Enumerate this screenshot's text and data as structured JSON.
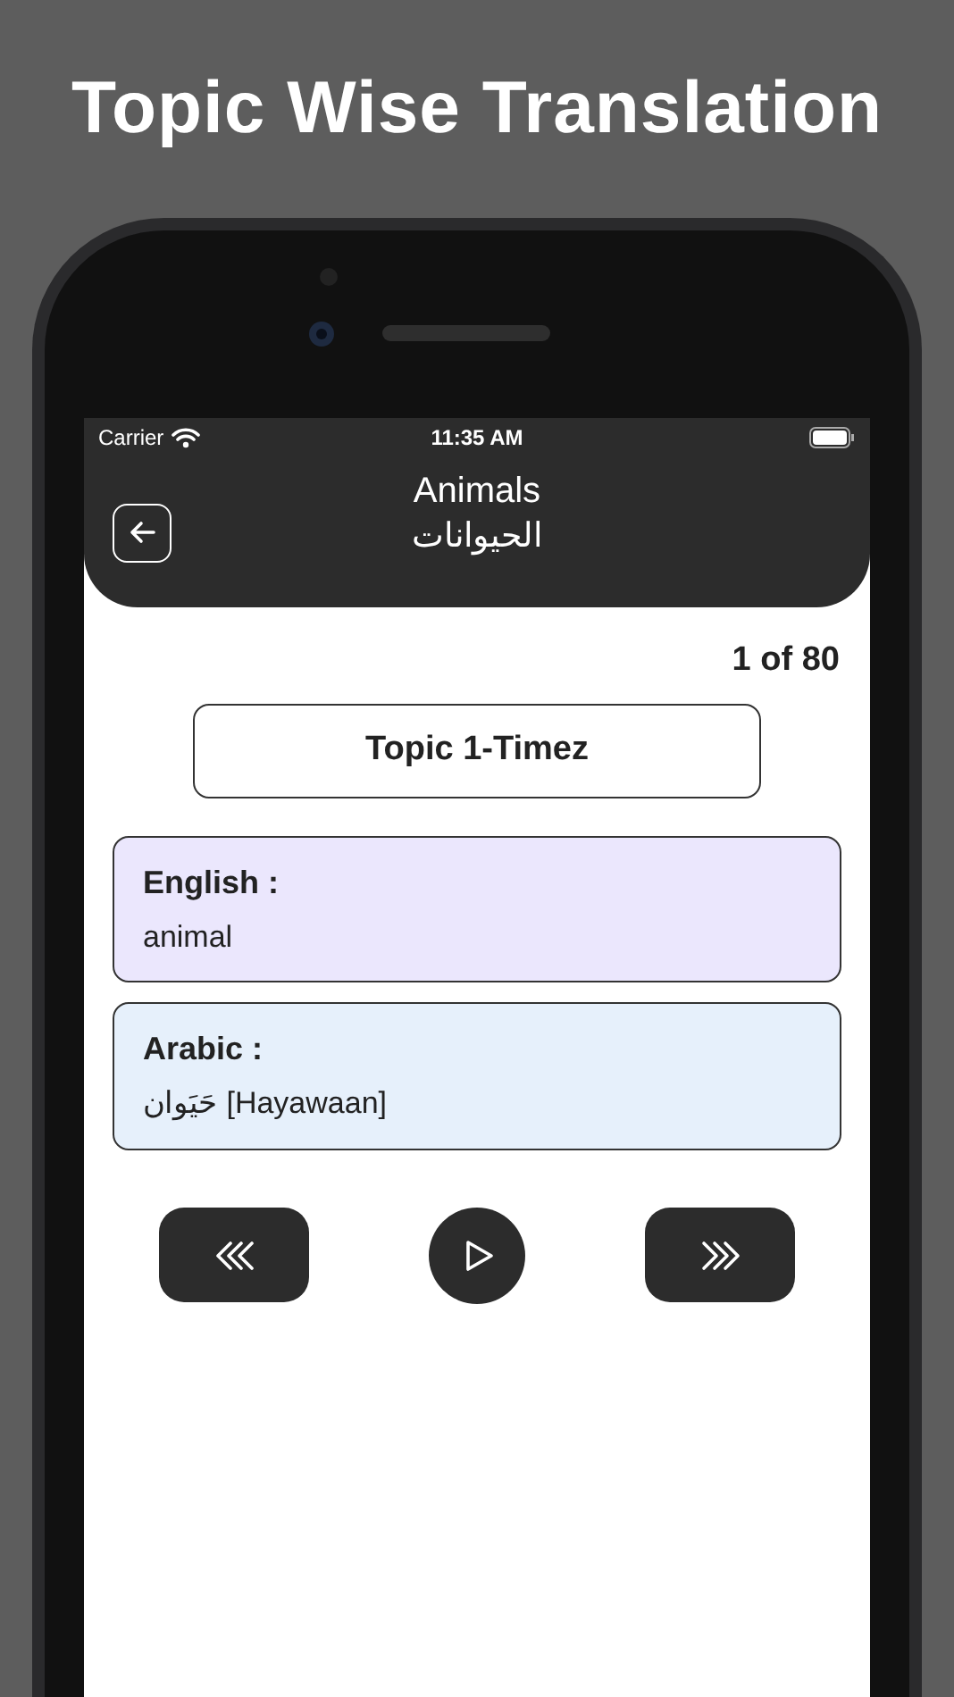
{
  "headline": "Topic Wise Translation",
  "status_bar": {
    "carrier": "Carrier",
    "time": "11:35 AM"
  },
  "header": {
    "title": "Animals",
    "subtitle": "الحيوانات"
  },
  "counter": "1 of 80",
  "topic": "Topic 1-Timez",
  "cards": [
    {
      "label": "English :",
      "value": "animal",
      "color": "#ebe7fd"
    },
    {
      "label": "Arabic :",
      "value": "حَيَوان [Hayawaan]",
      "color": "#e6f0fb"
    }
  ],
  "controls": [
    {
      "kind": "previous"
    },
    {
      "kind": "play"
    },
    {
      "kind": "next"
    }
  ]
}
